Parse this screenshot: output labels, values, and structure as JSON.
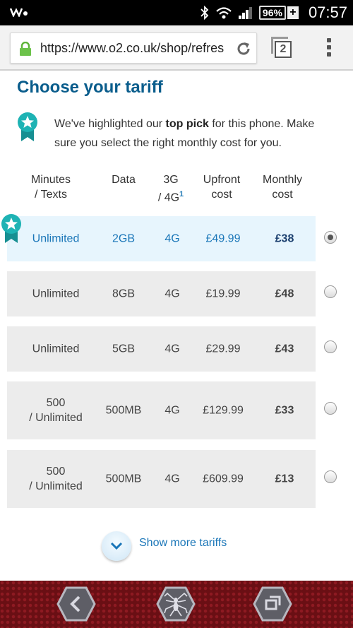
{
  "status_bar": {
    "battery": "96%",
    "time": "07:57"
  },
  "browser": {
    "url": "https://www.o2.co.uk/shop/refres",
    "tab_count": "2"
  },
  "page": {
    "title": "Choose your tariff",
    "intro_before": "We've highlighted our ",
    "intro_bold": "top pick",
    "intro_after": " for this phone. Make sure you select the right monthly cost for you."
  },
  "table": {
    "headers": {
      "minutes": "Minutes\n/ Texts",
      "data": "Data",
      "network": "3G\n/ 4G",
      "network_footnote": "1",
      "upfront": "Upfront\ncost",
      "monthly": "Monthly\ncost"
    },
    "rows": [
      {
        "minutes": "Unlimited",
        "data": "2GB",
        "network": "4G",
        "upfront": "£49.99",
        "monthly": "£38",
        "selected": true,
        "top_pick": true
      },
      {
        "minutes": "Unlimited",
        "data": "8GB",
        "network": "4G",
        "upfront": "£19.99",
        "monthly": "£48",
        "selected": false
      },
      {
        "minutes": "Unlimited",
        "data": "5GB",
        "network": "4G",
        "upfront": "£29.99",
        "monthly": "£43",
        "selected": false
      },
      {
        "minutes": "500\n/ Unlimited",
        "data": "500MB",
        "network": "4G",
        "upfront": "£129.99",
        "monthly": "£33",
        "selected": false
      },
      {
        "minutes": "500\n/ Unlimited",
        "data": "500MB",
        "network": "4G",
        "upfront": "£609.99",
        "monthly": "£13",
        "selected": false
      }
    ]
  },
  "show_more_label": "Show more tariffs",
  "colors": {
    "brand_blue": "#0a5d8c",
    "link_blue": "#1a76b8",
    "badge_teal": "#1eb3b4",
    "selected_row": "#e7f5fd",
    "row_bg": "#ececec"
  },
  "icons": {
    "badge": "award-ribbon-icon",
    "expand": "chevron-down-icon",
    "nav_back": "back-icon",
    "nav_home": "spider-home-icon",
    "nav_recent": "recent-apps-icon"
  }
}
